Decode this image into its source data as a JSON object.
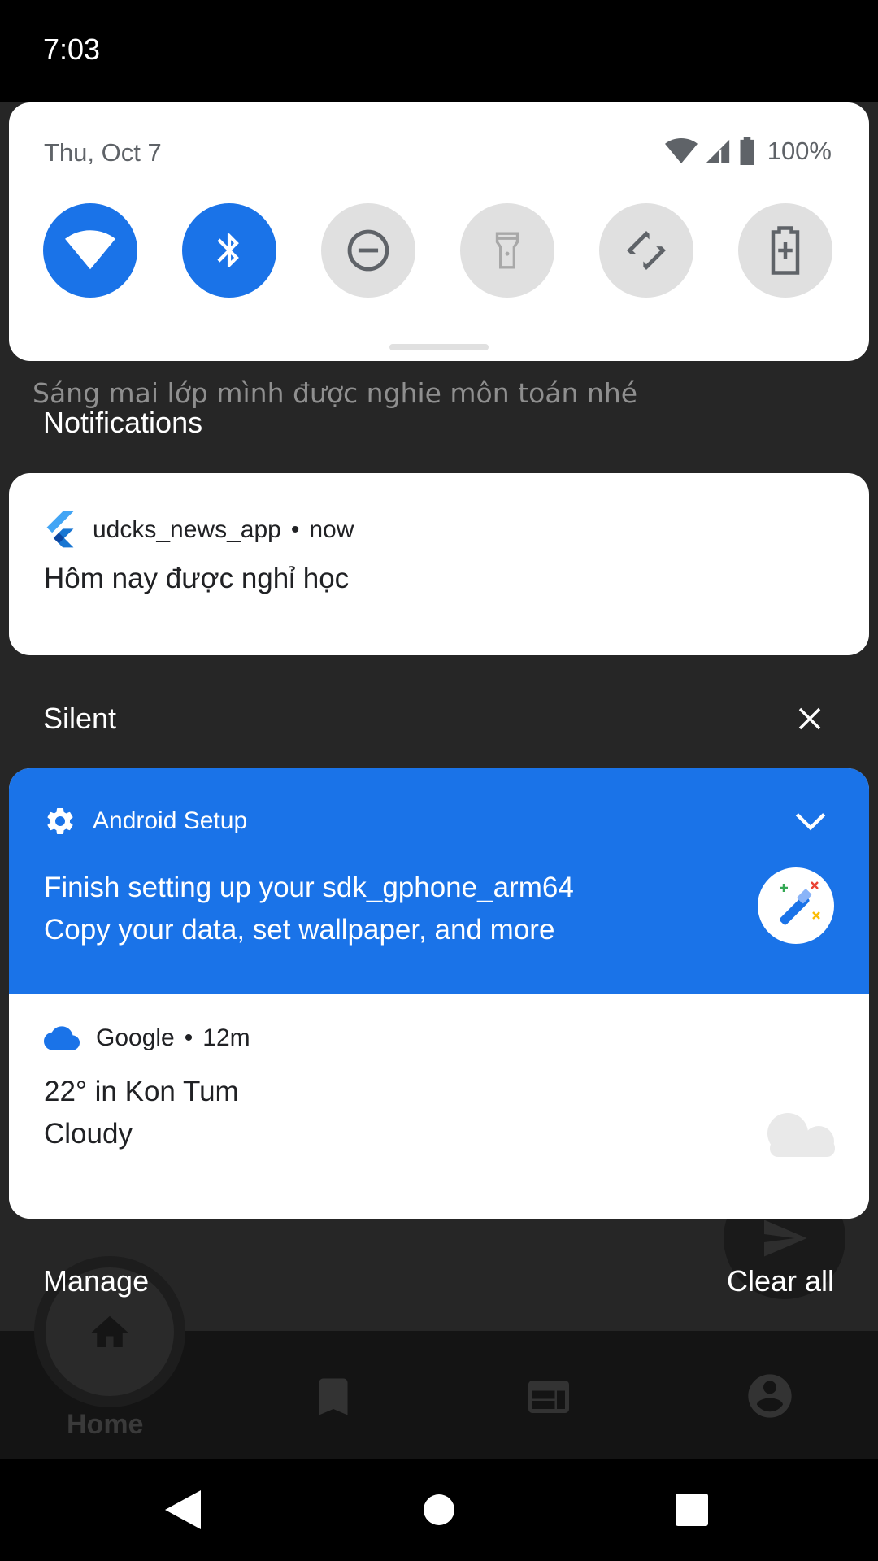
{
  "status_bar": {
    "time": "7:03"
  },
  "quick_settings": {
    "date": "Thu, Oct 7",
    "battery_percent": "100%",
    "tiles": [
      {
        "name": "Wi-Fi",
        "icon": "wifi-icon",
        "state": "on"
      },
      {
        "name": "Bluetooth",
        "icon": "bluetooth-icon",
        "state": "on"
      },
      {
        "name": "Do not disturb",
        "icon": "do-not-disturb-icon",
        "state": "off"
      },
      {
        "name": "Flashlight",
        "icon": "flashlight-icon",
        "state": "off"
      },
      {
        "name": "Auto-rotate",
        "icon": "auto-rotate-icon",
        "state": "off"
      },
      {
        "name": "Battery saver",
        "icon": "battery-saver-icon",
        "state": "off"
      }
    ]
  },
  "background_app": {
    "subtitle_text": "Sáng mai lớp mình được nghie môn toán nhé",
    "nav_home_label": "Home"
  },
  "notifications": {
    "section_label": "Notifications",
    "news": {
      "app_name": "udcks_news_app",
      "time": "now",
      "text": "Hôm nay được nghỉ học"
    }
  },
  "silent": {
    "section_label": "Silent",
    "setup": {
      "app_name": "Android Setup",
      "title": "Finish setting up your sdk_gphone_arm64",
      "text": "Copy your data, set wallpaper, and more"
    },
    "weather": {
      "app_name": "Google",
      "time": "12m",
      "title": "22° in Kon Tum",
      "text": "Cloudy"
    }
  },
  "footer": {
    "manage_label": "Manage",
    "clear_all_label": "Clear all"
  },
  "colors": {
    "accent": "#1a73e8",
    "tile_off": "#e0e0e0",
    "scrim": "#1e1e1e"
  }
}
